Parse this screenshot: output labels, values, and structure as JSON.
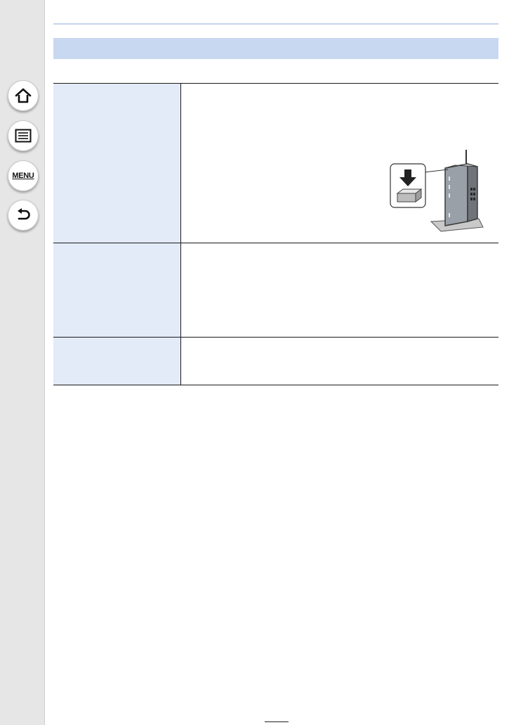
{
  "sidebar": {
    "home_icon": "home-icon",
    "contents_icon": "list-icon",
    "menu_label": "MENU",
    "back_icon": "return-icon"
  },
  "section": {
    "title": ""
  },
  "table": {
    "rows": [
      {
        "label": "",
        "description": "",
        "illustration": "wireless-router-wps-button"
      },
      {
        "label": "",
        "description": ""
      },
      {
        "label": "",
        "description": ""
      }
    ]
  },
  "footer": {
    "page_number": ""
  },
  "colors": {
    "sidebar_bg": "#e6e6e6",
    "header_bar": "#c9d8f1",
    "label_cell": "#e3eaf8",
    "border": "#1a1a1a"
  }
}
